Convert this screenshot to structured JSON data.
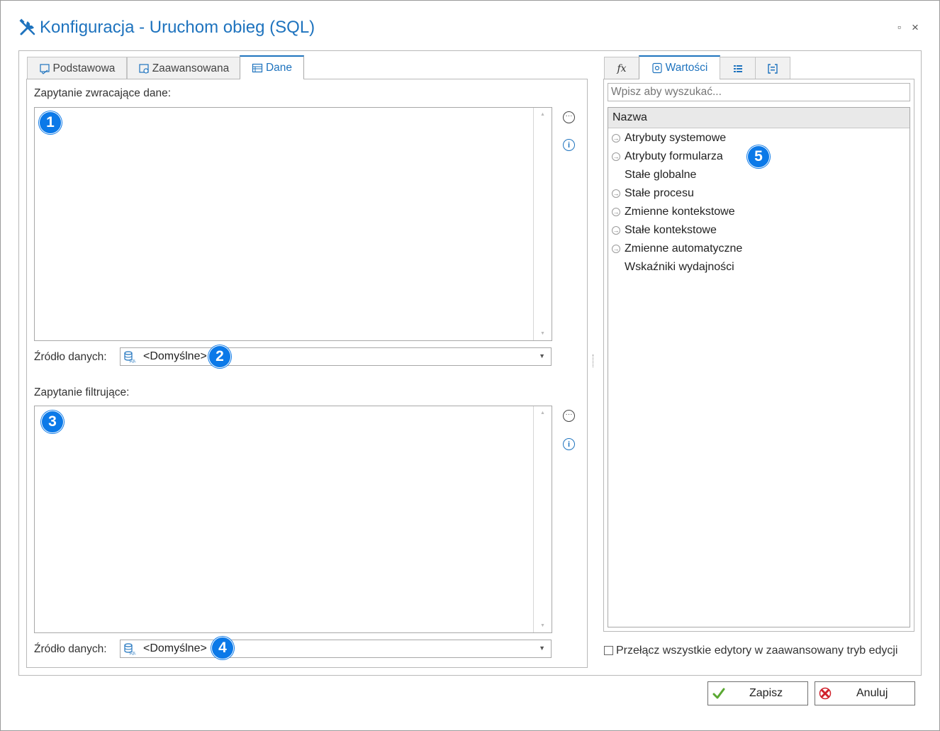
{
  "window": {
    "title": "Konfiguracja - Uruchom obieg (SQL)",
    "maximize_glyph": "▫",
    "close_glyph": "×"
  },
  "left_tabs": [
    {
      "label": "Podstawowa",
      "icon": "form-icon"
    },
    {
      "label": "Zaawansowana",
      "icon": "settings-form-icon"
    },
    {
      "label": "Dane",
      "icon": "table-icon"
    }
  ],
  "data_query": {
    "label": "Zapytanie zwracające dane:",
    "badge": "1",
    "source_label": "Źródło danych:",
    "source_value": "<Domyślne>",
    "source_badge": "2"
  },
  "filter_query": {
    "label": "Zapytanie filtrujące:",
    "badge": "3",
    "source_label": "Źródło danych:",
    "source_value": "<Domyślne>",
    "source_badge": "4"
  },
  "right_tabs": [
    {
      "label": "",
      "icon": "function-icon"
    },
    {
      "label": "Wartości",
      "icon": "values-icon"
    },
    {
      "label": "",
      "icon": "list-icon"
    },
    {
      "label": "",
      "icon": "bracket-icon"
    }
  ],
  "search": {
    "placeholder": "Wpisz aby wyszukać..."
  },
  "tree": {
    "column": "Nazwa",
    "badge": "5",
    "items": [
      {
        "label": "Atrybuty systemowe",
        "expandable": true
      },
      {
        "label": "Atrybuty formularza",
        "expandable": true
      },
      {
        "label": "Stałe globalne",
        "expandable": false
      },
      {
        "label": "Stałe procesu",
        "expandable": true
      },
      {
        "label": "Zmienne kontekstowe",
        "expandable": true
      },
      {
        "label": "Stałe kontekstowe",
        "expandable": true
      },
      {
        "label": "Zmienne automatyczne",
        "expandable": true
      },
      {
        "label": "Wskaźniki wydajności",
        "expandable": false
      }
    ]
  },
  "advanced_toggle": {
    "label": "Przełącz wszystkie edytory w zaawansowany tryb edycji",
    "checked": false
  },
  "buttons": {
    "save": "Zapisz",
    "cancel": "Anuluj"
  },
  "colors": {
    "accent": "#1e73be",
    "badge": "#0b79e8",
    "save_check": "#5aa832",
    "cancel_x": "#d0202a"
  }
}
